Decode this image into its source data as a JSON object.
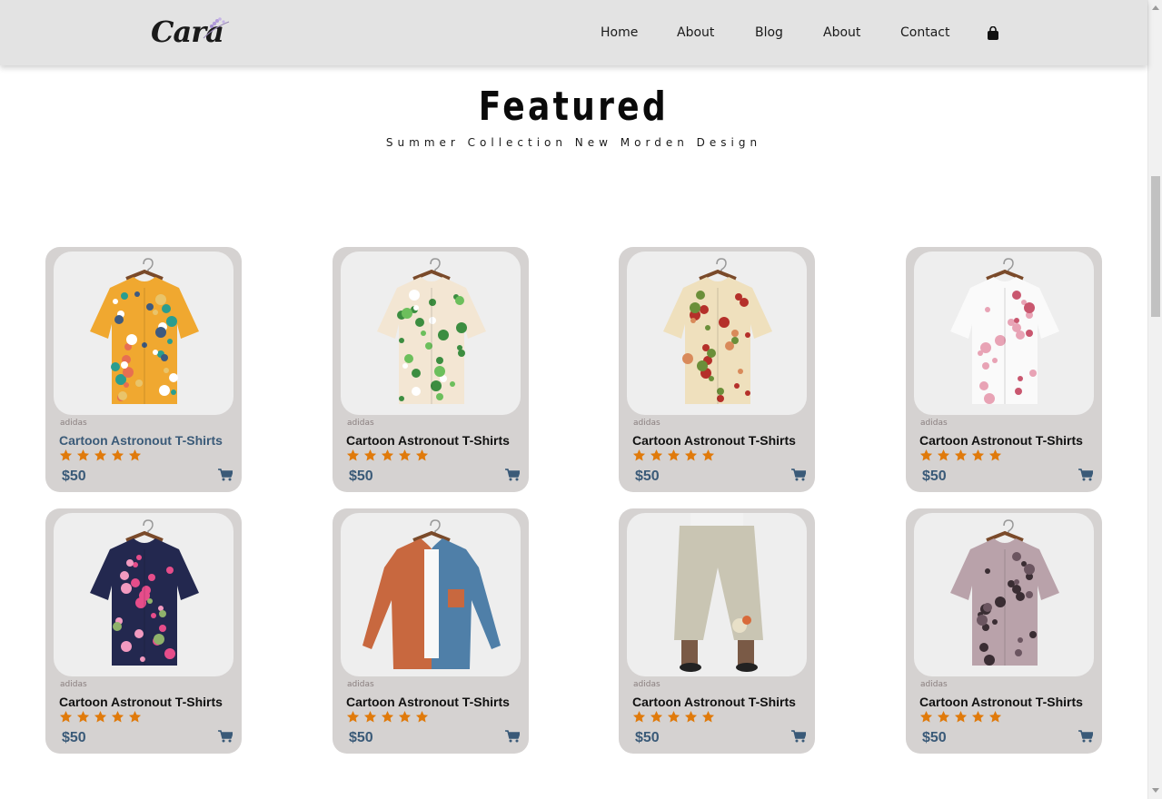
{
  "header": {
    "logo_text": "Cara",
    "nav": [
      "Home",
      "About",
      "Blog",
      "About",
      "Contact"
    ],
    "bag_icon": "shopping-bag-icon"
  },
  "featured": {
    "title": "Featured",
    "subtitle": "Summer Collection New Morden Design"
  },
  "colors": {
    "header_bg": "#e3e3e3",
    "card_bg": "#d5d2d1",
    "star": "#e07a0b",
    "price": "#3a5a78"
  },
  "products": [
    {
      "brand": "adidas",
      "name": "Cartoon Astronout T-Shirts",
      "rating": 5,
      "price": "$50",
      "image": "multicolor-floral-shirt",
      "cart_icon": "cart-icon"
    },
    {
      "brand": "adidas",
      "name": "Cartoon Astronout T-Shirts",
      "rating": 5,
      "price": "$50",
      "image": "green-leaf-shirt",
      "cart_icon": "cart-icon"
    },
    {
      "brand": "adidas",
      "name": "Cartoon Astronout T-Shirts",
      "rating": 5,
      "price": "$50",
      "image": "red-rose-shirt",
      "cart_icon": "cart-icon"
    },
    {
      "brand": "adidas",
      "name": "Cartoon Astronout T-Shirts",
      "rating": 5,
      "price": "$50",
      "image": "pink-blossom-shirt",
      "cart_icon": "cart-icon"
    },
    {
      "brand": "adidas",
      "name": "Cartoon Astronout T-Shirts",
      "rating": 5,
      "price": "$50",
      "image": "navy-floral-shirt",
      "cart_icon": "cart-icon"
    },
    {
      "brand": "adidas",
      "name": "Cartoon Astronout T-Shirts",
      "rating": 5,
      "price": "$50",
      "image": "orange-blue-jacket",
      "cart_icon": "cart-icon"
    },
    {
      "brand": "adidas",
      "name": "Cartoon Astronout T-Shirts",
      "rating": 5,
      "price": "$50",
      "image": "linen-pants",
      "cart_icon": "cart-icon"
    },
    {
      "brand": "adidas",
      "name": "Cartoon Astronout T-Shirts",
      "rating": 5,
      "price": "$50",
      "image": "mauve-print-blouse",
      "cart_icon": "cart-icon"
    }
  ]
}
